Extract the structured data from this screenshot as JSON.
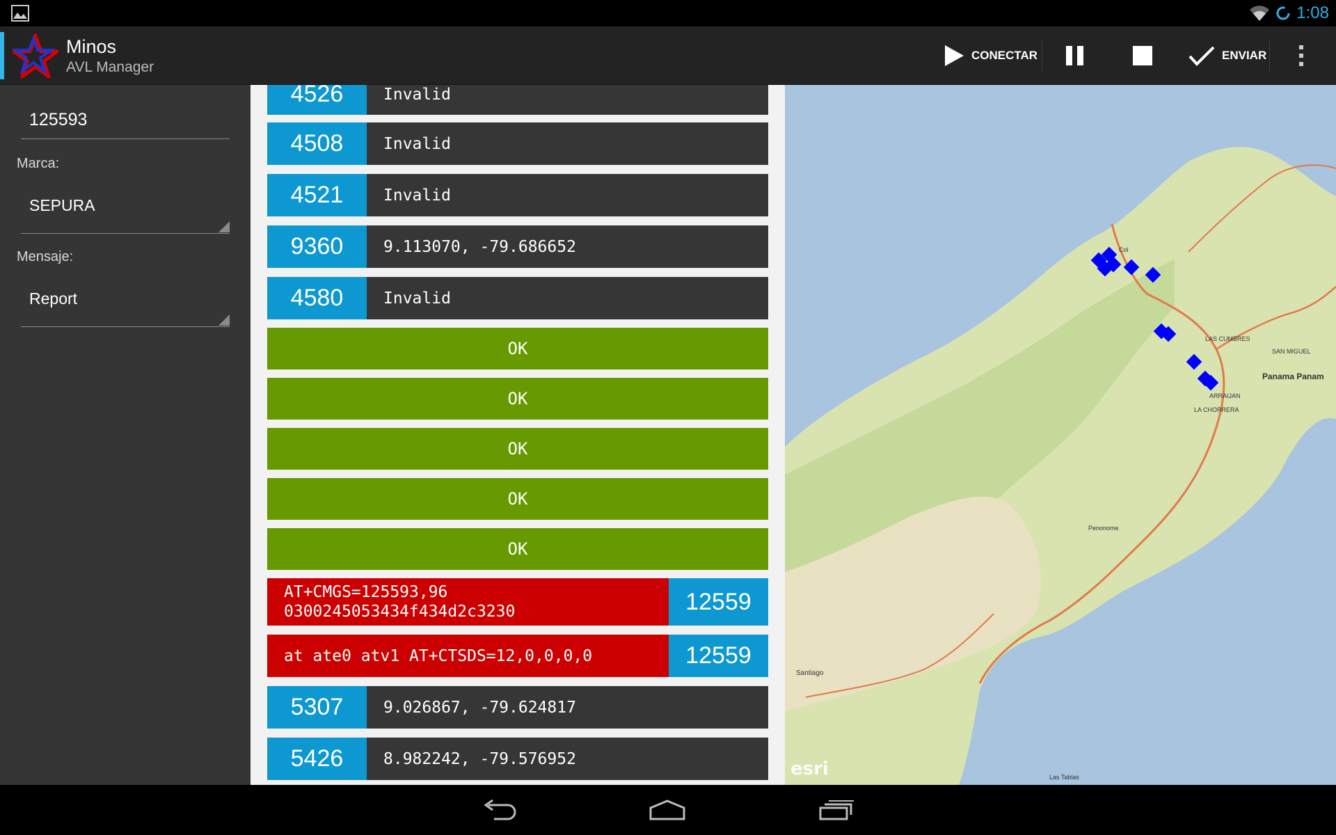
{
  "status_bar": {
    "time": "1:08"
  },
  "app_bar": {
    "title": "Minos",
    "subtitle": "AVL Manager",
    "actions": {
      "connect": "CONECTAR",
      "send": "ENVIAR"
    }
  },
  "left_panel": {
    "id_value": "125593",
    "brand_label": "Marca:",
    "brand_value": "SEPURA",
    "message_label": "Mensaje:",
    "message_value": "Report"
  },
  "list": {
    "top_partial": {
      "id": "4526",
      "text": "Invalid"
    },
    "entries": [
      {
        "id": "4508",
        "text": "Invalid"
      },
      {
        "id": "4521",
        "text": "Invalid"
      },
      {
        "id": "9360",
        "text": "9.113070, -79.686652"
      },
      {
        "id": "4580",
        "text": "Invalid"
      }
    ],
    "ok_rows": [
      "OK",
      "OK",
      "OK",
      "OK",
      "OK"
    ],
    "commands": [
      {
        "line1": "AT+CMGS=125593,96",
        "line2": "0300245053434f434d2c3230",
        "id": "12559"
      },
      {
        "line1": "at ate0 atv1 AT+CTSDS=12,0,0,0,0",
        "id": "12559"
      }
    ],
    "bottom_entries": [
      {
        "id": "5307",
        "text": "9.026867, -79.624817"
      },
      {
        "id": "5426",
        "text": "8.982242, -79.576952"
      }
    ]
  },
  "map": {
    "attribution": "esri",
    "labels": {
      "penonome": "Penonome",
      "santiago": "Santiago",
      "la_chorrera": "LA CHORRERA",
      "las_cumbres": "LAS CUMBRES",
      "san_miguelito": "SAN MIGUEL",
      "panama": "Panama Panam",
      "las_tablas": "Las Tablas",
      "colon": "Col",
      "arraijan": "ARRAIJAN"
    },
    "marker_color": "#0000ff"
  }
}
